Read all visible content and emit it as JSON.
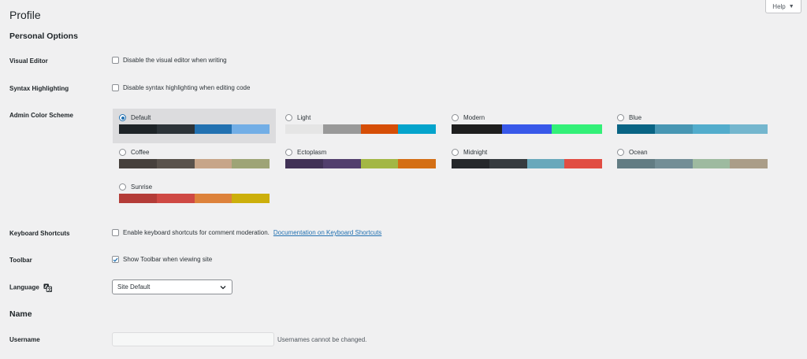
{
  "page": {
    "title": "Profile",
    "help_label": "Help"
  },
  "personal_options": {
    "title": "Personal Options",
    "visual_editor": {
      "label": "Visual Editor",
      "checkbox_label": "Disable the visual editor when writing",
      "checked": false
    },
    "syntax_highlighting": {
      "label": "Syntax Highlighting",
      "checkbox_label": "Disable syntax highlighting when editing code",
      "checked": false
    },
    "admin_color_scheme": {
      "label": "Admin Color Scheme",
      "selected": "Default",
      "schemes": [
        {
          "name": "Default",
          "colors": [
            "#1d2327",
            "#2c3338",
            "#2271b1",
            "#72aee6"
          ]
        },
        {
          "name": "Light",
          "colors": [
            "#e5e5e5",
            "#999999",
            "#d64e07",
            "#04a4cc"
          ]
        },
        {
          "name": "Modern",
          "colors": [
            "#1e1e1e",
            "#3858e9",
            "#33f078"
          ]
        },
        {
          "name": "Blue",
          "colors": [
            "#096484",
            "#4796b3",
            "#52accc",
            "#74b6ce"
          ]
        },
        {
          "name": "Coffee",
          "colors": [
            "#46403c",
            "#59524c",
            "#c7a589",
            "#9ea476"
          ]
        },
        {
          "name": "Ectoplasm",
          "colors": [
            "#413256",
            "#523f6d",
            "#a3b745",
            "#d46f15"
          ]
        },
        {
          "name": "Midnight",
          "colors": [
            "#25282b",
            "#363b3f",
            "#69a8bb",
            "#e14d43"
          ]
        },
        {
          "name": "Ocean",
          "colors": [
            "#627c83",
            "#738e96",
            "#9ebaa0",
            "#aa9d88"
          ]
        },
        {
          "name": "Sunrise",
          "colors": [
            "#b43c38",
            "#cf4944",
            "#dd823b",
            "#ccaf0b"
          ]
        }
      ]
    },
    "keyboard_shortcuts": {
      "label": "Keyboard Shortcuts",
      "checkbox_label": "Enable keyboard shortcuts for comment moderation.",
      "link_label": "Documentation on Keyboard Shortcuts",
      "checked": false
    },
    "toolbar": {
      "label": "Toolbar",
      "checkbox_label": "Show Toolbar when viewing site",
      "checked": true
    },
    "language": {
      "label": "Language",
      "icon": "translate-icon",
      "selected_value": "Site Default"
    }
  },
  "name_section": {
    "title": "Name",
    "username": {
      "label": "Username",
      "value": "",
      "note": "Usernames cannot be changed."
    }
  },
  "colors": {
    "accent": "#2271b1",
    "background": "#f0f0f1",
    "selected_scheme_bg": "#dcdcde"
  }
}
